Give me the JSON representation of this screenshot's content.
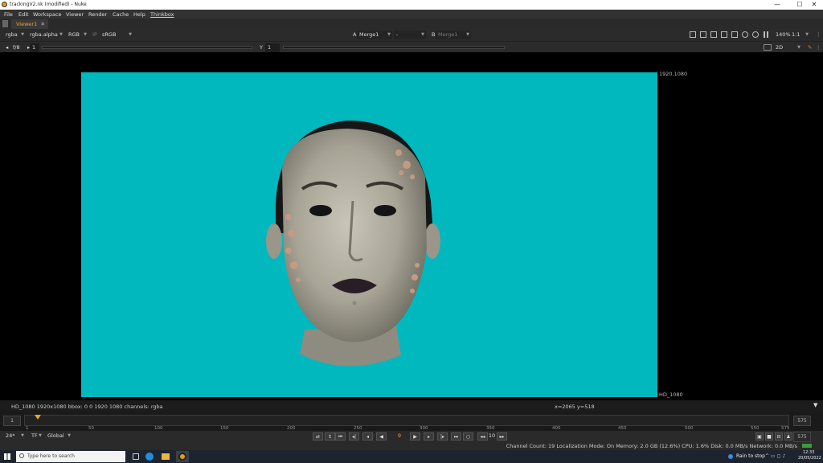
{
  "window": {
    "title": "trackingV2.nk (modified) - Nuke",
    "min": "—",
    "max": "☐",
    "close": "✕"
  },
  "menu": [
    "File",
    "Edit",
    "Workspace",
    "Viewer",
    "Render",
    "Cache",
    "Help",
    "Thinkbox"
  ],
  "tab": {
    "label": "Viewer1",
    "close": "✕"
  },
  "controls": {
    "channels": "rgba",
    "alpha": "rgba.alpha",
    "display": "RGB",
    "ip": "IP",
    "colorspace": "sRGB",
    "a_label": "A",
    "a_input": "Merge1",
    "op": "-",
    "b_label": "B",
    "b_input": "Merge1",
    "zoom": "140%",
    "ratio": "1:1",
    "view_mode": "2D"
  },
  "gain": {
    "fstop": "f/8",
    "gain_value": "1",
    "gamma_label": "Y",
    "gamma_value": "1"
  },
  "viewer": {
    "format_top_right": "1920,1080",
    "format_bottom_right": "HD_1080"
  },
  "info": {
    "left": "HD_1080 1920x1080  bbox: 0 0 1920 1080 channels: rgba",
    "coords": "x=2065 y=518"
  },
  "timeline": {
    "start": "1",
    "end": "575",
    "ticks": [
      "1",
      "50",
      "100",
      "150",
      "200",
      "250",
      "300",
      "350",
      "400",
      "450",
      "500",
      "550",
      "575"
    ],
    "current_frame_fraction": 0.0174
  },
  "playback": {
    "fps": "24*",
    "tf": "TF",
    "scope": "Global",
    "current_frame": "9",
    "step": "10",
    "end_frame": "575"
  },
  "status": {
    "text": "Channel Count: 19  Localization Mode: On  Memory: 2.0 GB (12.6%)  CPU: 1.6%  Disk: 0.0 MB/s  Network: 0.0 MB/s"
  },
  "taskbar": {
    "search_placeholder": "Type here to search",
    "weather": "Rain to stop",
    "time": "12:33",
    "date": "20/05/2022"
  },
  "colors": {
    "viewer_bg": "#00b8bd",
    "accent": "#f0a030"
  }
}
